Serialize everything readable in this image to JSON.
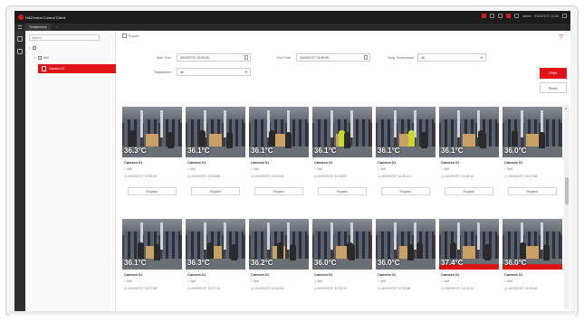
{
  "app": {
    "title": "HikCentral Control Client",
    "user": "admin · 2020/07/27 13:05"
  },
  "nav": {
    "tab": "Temperature"
  },
  "tree": {
    "search_placeholder": "Search",
    "root": "",
    "child": "Self",
    "selected": "Camera 01"
  },
  "toolbar": {
    "export_label": "Export"
  },
  "filters": {
    "start_time_label": "Start Time",
    "start_time_value": "2020/07/27 00:00:00",
    "end_time_label": "End Time",
    "end_time_value": "2020/07/27 23:59:59",
    "body_temp_label": "Body Temperature",
    "body_temp_value": "All",
    "registration_label": "Registration",
    "registration_value": "All",
    "filter_button": "Filter",
    "reset_button": "Reset"
  },
  "colors": {
    "accent": "#e01414",
    "titlebar": "#1b1b1b"
  },
  "cards": [
    {
      "temp": "36.3°C",
      "camera": "Camera 01",
      "site": "Self",
      "time": "2020/07/27 12:30:20",
      "action": "Register",
      "yellow": false,
      "alarm": false
    },
    {
      "temp": "36.1°C",
      "camera": "Camera 01",
      "site": "Self",
      "time": "2020/07/27 12:29:56",
      "action": "Register",
      "yellow": false,
      "alarm": false
    },
    {
      "temp": "36.1°C",
      "camera": "Camera 01",
      "site": "Self",
      "time": "2020/07/27 12:29:40",
      "action": "Register",
      "yellow": false,
      "alarm": false
    },
    {
      "temp": "36.1°C",
      "camera": "Camera 01",
      "site": "Self",
      "time": "2020/07/27 12:28:57",
      "action": "Register",
      "yellow": true,
      "alarm": false
    },
    {
      "temp": "36.1°C",
      "camera": "Camera 01",
      "site": "Self",
      "time": "2020/07/27 12:28:31",
      "action": "Register",
      "yellow": true,
      "alarm": false
    },
    {
      "temp": "36.1°C",
      "camera": "Camera 01",
      "site": "Self",
      "time": "2020/07/27 12:28:12",
      "action": "Register",
      "yellow": false,
      "alarm": false
    },
    {
      "temp": "36.0°C",
      "camera": "Camera 01",
      "site": "Self",
      "time": "2020/07/27 12:27:58",
      "action": "Register",
      "yellow": false,
      "alarm": false
    },
    {
      "temp": "36.1°C",
      "camera": "Camera 01",
      "site": "Self",
      "time": "2020/07/27 12:27:30",
      "action": "",
      "yellow": false,
      "alarm": false
    },
    {
      "temp": "36.3°C",
      "camera": "Camera 01",
      "site": "Self",
      "time": "2020/07/27 12:27:10",
      "action": "",
      "yellow": false,
      "alarm": false
    },
    {
      "temp": "36.2°C",
      "camera": "Camera 01",
      "site": "Self",
      "time": "2020/07/27 12:26:44",
      "action": "",
      "yellow": false,
      "alarm": false
    },
    {
      "temp": "36.0°C",
      "camera": "Camera 01",
      "site": "Self",
      "time": "2020/07/27 12:26:20",
      "action": "",
      "yellow": false,
      "alarm": false
    },
    {
      "temp": "36.0°C",
      "camera": "Camera 01",
      "site": "Self",
      "time": "2020/07/27 12:25:58",
      "action": "",
      "yellow": false,
      "alarm": false
    },
    {
      "temp": "37.4°C",
      "camera": "Camera 01",
      "site": "Self",
      "time": "2020/07/27 12:25:31",
      "action": "",
      "yellow": false,
      "alarm": true
    },
    {
      "temp": "36.0°C",
      "camera": "Camera 01",
      "site": "Self",
      "time": "2020/07/27 12:25:06",
      "action": "",
      "yellow": false,
      "alarm": true
    }
  ]
}
